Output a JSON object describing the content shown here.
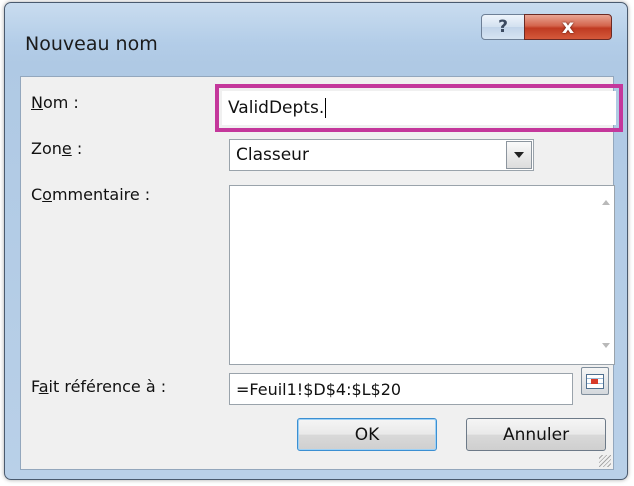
{
  "dialog": {
    "title": "Nouveau nom",
    "help_glyph": "?",
    "close_glyph": "x"
  },
  "name_field": {
    "label_underlined": "N",
    "label_rest": "om :",
    "value": "ValidDepts."
  },
  "scope_field": {
    "label_start": "Zon",
    "label_underlined": "e",
    "label_end": " :",
    "value": "Classeur"
  },
  "comment_field": {
    "label_start": "C",
    "label_underlined": "o",
    "label_end": "mmentaire :",
    "value": ""
  },
  "refers_to_field": {
    "label_start": "F",
    "label_underlined": "a",
    "label_end": "it référence à :",
    "value": "=Feuil1!$D$4:$L$20"
  },
  "buttons": {
    "ok": "OK",
    "cancel": "Annuler"
  },
  "colors": {
    "highlight": "#c4379b",
    "close_button": "#c03a22"
  },
  "icons": {
    "help": "question-mark-icon",
    "close": "close-icon",
    "dropdown": "chevron-down-icon",
    "range_select": "range-select-icon"
  }
}
